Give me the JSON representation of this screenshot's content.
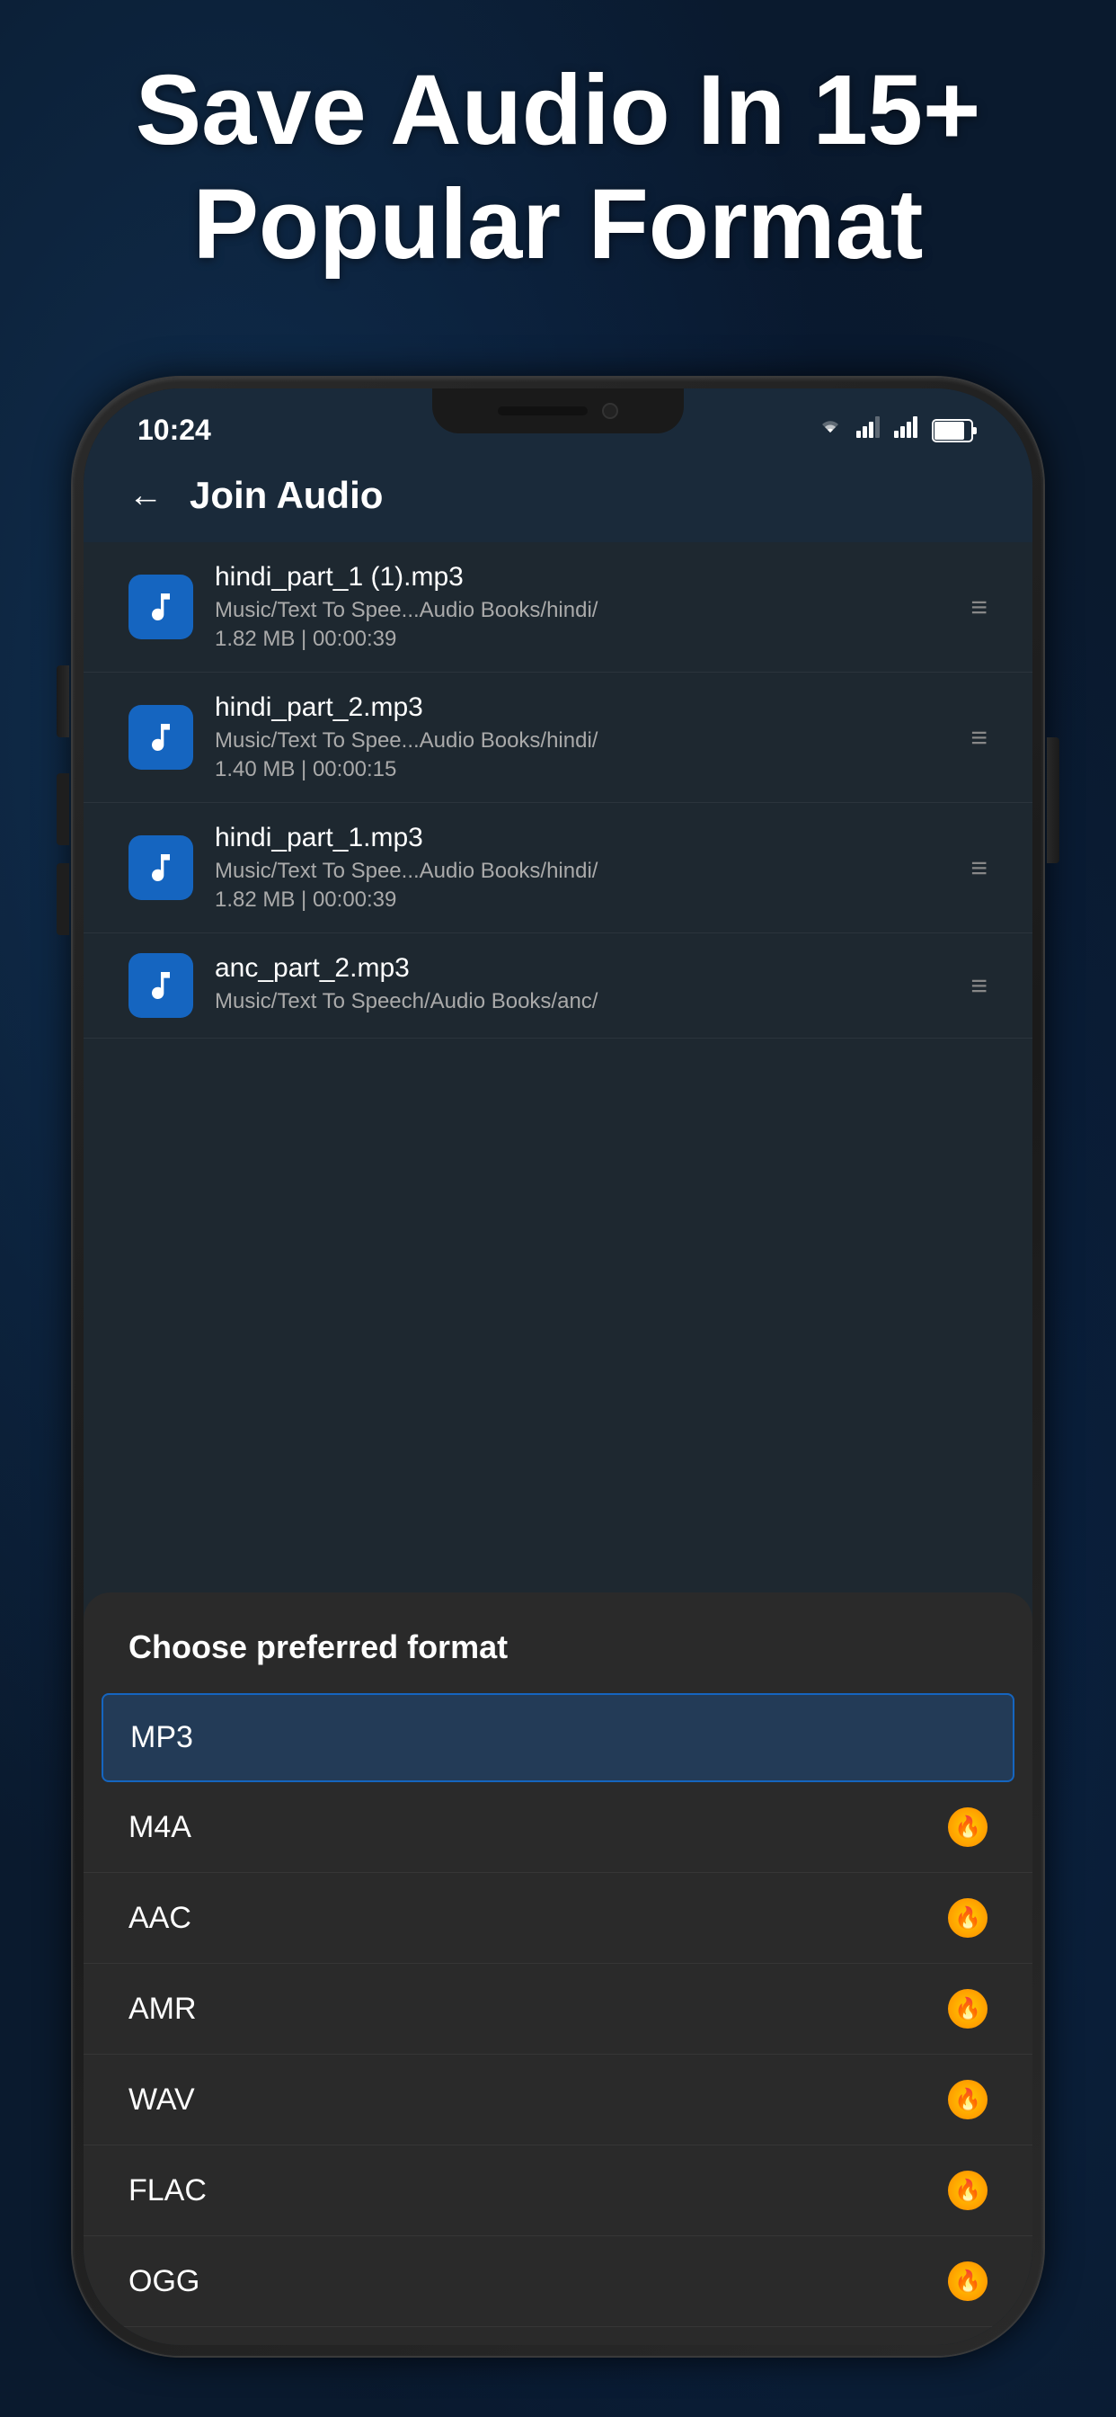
{
  "hero": {
    "title_line1": "Save Audio In 15+",
    "title_line2": "Popular Format"
  },
  "status_bar": {
    "time": "10:24",
    "battery": "74"
  },
  "header": {
    "title": "Join Audio",
    "back_label": "←"
  },
  "files": [
    {
      "name": "hindi_part_1 (1).mp3",
      "path": "Music/Text To Spee...Audio Books/hindi/",
      "meta": "1.82 MB | 00:00:39"
    },
    {
      "name": "hindi_part_2.mp3",
      "path": "Music/Text To Spee...Audio Books/hindi/",
      "meta": "1.40 MB | 00:00:15"
    },
    {
      "name": "hindi_part_1.mp3",
      "path": "Music/Text To Spee...Audio Books/hindi/",
      "meta": "1.82 MB | 00:00:39"
    },
    {
      "name": "anc_part_2.mp3",
      "path": "Music/Text To Speech/Audio Books/anc/",
      "meta": ""
    }
  ],
  "bottom_sheet": {
    "title": "Choose preferred format",
    "formats": [
      {
        "label": "MP3",
        "selected": true,
        "premium": false
      },
      {
        "label": "M4A",
        "selected": false,
        "premium": true
      },
      {
        "label": "AAC",
        "selected": false,
        "premium": true
      },
      {
        "label": "AMR",
        "selected": false,
        "premium": true
      },
      {
        "label": "WAV",
        "selected": false,
        "premium": true
      },
      {
        "label": "FLAC",
        "selected": false,
        "premium": true
      },
      {
        "label": "OGG",
        "selected": false,
        "premium": true
      }
    ]
  },
  "colors": {
    "accent": "#1565c0",
    "premium": "#ff8800",
    "selected_bg": "rgba(21,101,192,0.3)",
    "background": "#1e2830",
    "sheet_bg": "#2a2a2a"
  }
}
